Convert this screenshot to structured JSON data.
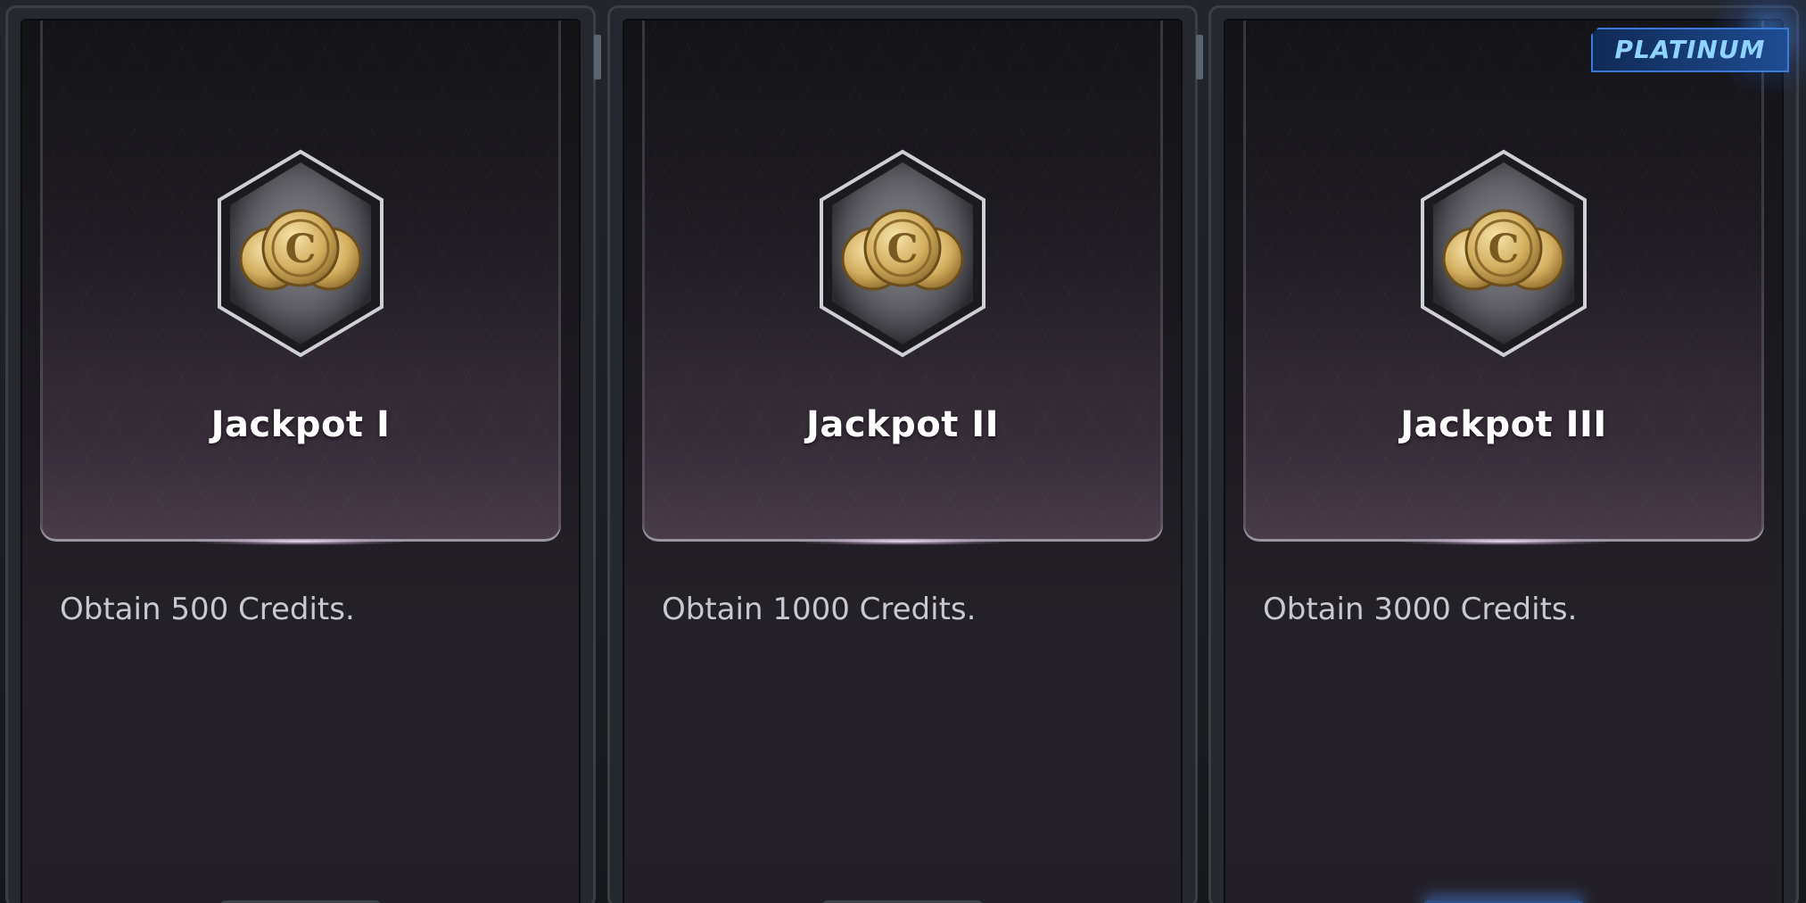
{
  "cards": [
    {
      "title": "Jackpot I",
      "description": "Obtain 500 Credits.",
      "icon": "credits-coins-icon",
      "tier": ""
    },
    {
      "title": "Jackpot II",
      "description": "Obtain 1000 Credits.",
      "icon": "credits-coins-icon",
      "tier": ""
    },
    {
      "title": "Jackpot III",
      "description": "Obtain 3000 Credits.",
      "icon": "credits-coins-icon",
      "tier": "PLATINUM"
    }
  ],
  "colors": {
    "gold": "#d8b76a",
    "platinum_text": "#8fd3ff",
    "platinum_bg": "#1f4c92"
  }
}
